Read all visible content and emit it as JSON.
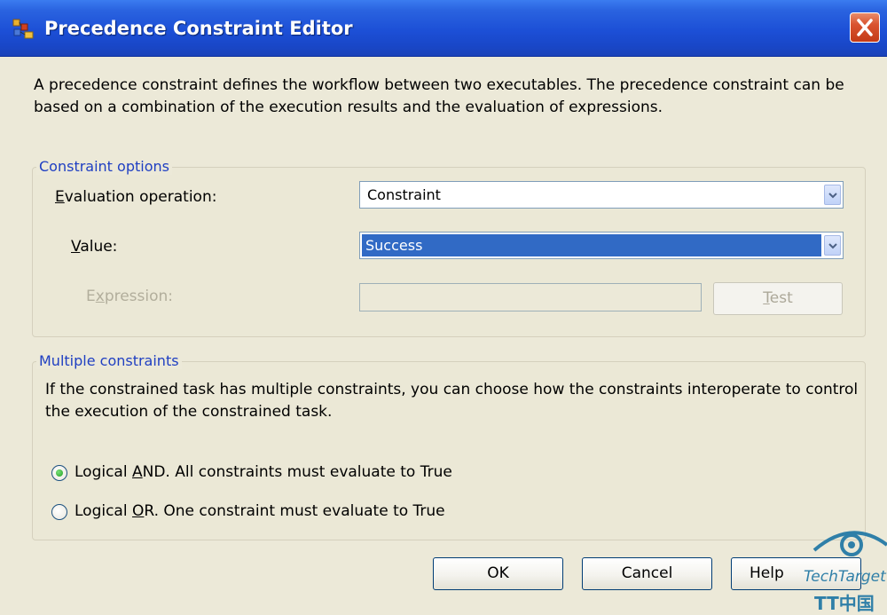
{
  "window": {
    "title": "Precedence Constraint Editor"
  },
  "description": "A precedence constraint defines the workflow between two executables. The precedence constraint can be based on a combination of the execution results and the evaluation of expressions.",
  "constraint_options": {
    "legend": "Constraint options",
    "evaluation_operation": {
      "label_prefix": "",
      "label_accel": "E",
      "label_rest": "valuation operation:",
      "value": "Constraint"
    },
    "value_field": {
      "label_accel": "V",
      "label_rest": "alue:",
      "value": "Success"
    },
    "expression": {
      "label_prefix": "E",
      "label_accel": "x",
      "label_rest": "pression:",
      "value": ""
    },
    "test_button": {
      "label_accel": "T",
      "label_rest": "est"
    }
  },
  "multiple_constraints": {
    "legend": "Multiple constraints",
    "description": "If the constrained task has multiple constraints, you can choose how the constraints interoperate to control the execution of the constrained task.",
    "options": [
      {
        "prefix": "Logical ",
        "accel": "A",
        "rest": "ND. All constraints must evaluate to True",
        "checked": true
      },
      {
        "prefix": "Logical ",
        "accel": "O",
        "rest": "R. One constraint must evaluate to True",
        "checked": false
      }
    ]
  },
  "buttons": {
    "ok": "OK",
    "cancel": "Cancel",
    "help": "Help"
  },
  "watermark": {
    "brand": "TechTarget",
    "sub": "TT中国"
  },
  "colors": {
    "titlebar": "#1c4fd6",
    "close": "#d9532f",
    "selection": "#316ac5",
    "group_legend": "#1f3fc2"
  }
}
